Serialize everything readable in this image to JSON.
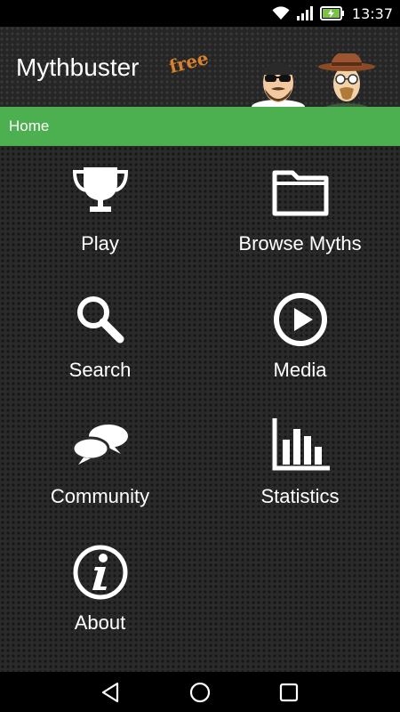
{
  "status_bar": {
    "time": "13:37",
    "icons": [
      "wifi-icon",
      "cellular-signal-icon",
      "battery-charging-icon"
    ]
  },
  "header": {
    "title": "Mythbuster",
    "badge": "free"
  },
  "breadcrumb": {
    "label": "Home"
  },
  "menu": [
    {
      "label": "Play",
      "icon": "trophy-icon"
    },
    {
      "label": "Browse Myths",
      "icon": "folder-icon"
    },
    {
      "label": "Search",
      "icon": "magnifier-icon"
    },
    {
      "label": "Media",
      "icon": "play-circle-icon"
    },
    {
      "label": "Community",
      "icon": "chat-bubbles-icon"
    },
    {
      "label": "Statistics",
      "icon": "bar-chart-icon"
    },
    {
      "label": "About",
      "icon": "info-icon"
    }
  ],
  "nav": {
    "buttons": [
      "back-icon",
      "home-icon",
      "recents-icon"
    ]
  },
  "colors": {
    "accent": "#4caf50",
    "badge": "#d9822b",
    "background": "#2a2a2a"
  }
}
